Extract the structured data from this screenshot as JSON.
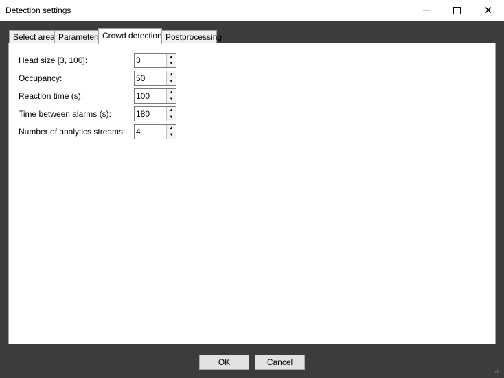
{
  "window": {
    "title": "Detection settings",
    "controls": {
      "minimize_icon": "minimize-icon",
      "maximize_icon": "maximize-icon",
      "close_icon": "close-icon",
      "close_glyph": "✕"
    }
  },
  "tabs": [
    {
      "label": "Select area",
      "active": false
    },
    {
      "label": "Parameters",
      "active": false
    },
    {
      "label": "Crowd detection",
      "active": true
    },
    {
      "label": "Postprocessing",
      "active": false
    }
  ],
  "fields": [
    {
      "label": "Head size [3, 100]:",
      "value": "3"
    },
    {
      "label": "Occupancy:",
      "value": "50"
    },
    {
      "label": "Reaction time (s):",
      "value": "100"
    },
    {
      "label": "Time between alarms (s):",
      "value": "180"
    },
    {
      "label": "Number of analytics streams:",
      "value": "4"
    }
  ],
  "spinner": {
    "up_glyph": "▲",
    "down_glyph": "▼"
  },
  "buttons": {
    "ok": "OK",
    "cancel": "Cancel"
  },
  "colors": {
    "client_background": "#3c3c3c",
    "page_background": "#ffffff",
    "button_face": "#e1e1e1"
  }
}
